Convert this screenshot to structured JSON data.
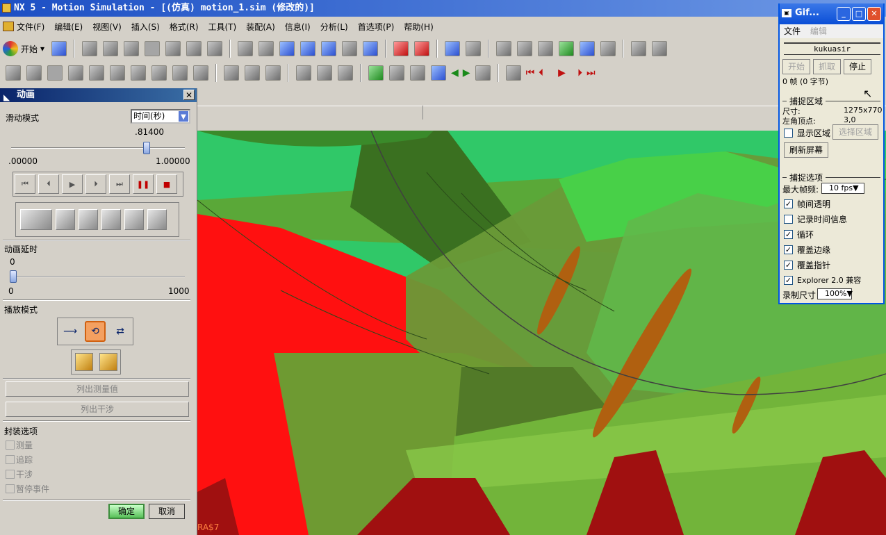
{
  "window": {
    "title": "NX 5 - Motion Simulation - [(仿真) motion_1.sim (修改的)]"
  },
  "menu": [
    "文件(F)",
    "编辑(E)",
    "视图(V)",
    "插入(S)",
    "格式(R)",
    "工具(T)",
    "装配(A)",
    "信息(I)",
    "分析(L)",
    "首选项(P)",
    "帮助(H)"
  ],
  "toolbar": {
    "start_label": "开始"
  },
  "panel": {
    "title": "动画",
    "slide_mode_label": "滑动模式",
    "slide_mode_value": "时间(秒)",
    "slider_value": ".81400",
    "slider_position": 0.814,
    "slider_min": ".00000",
    "slider_max": "1.00000",
    "delay_label": "动画延时",
    "delay_value": "0",
    "delay_min": "0",
    "delay_max": "1000",
    "play_mode_label": "播放模式",
    "list_measure_label": "列出测量值",
    "list_interference_label": "列出干涉",
    "encap_label": "封装选项",
    "encap_items": [
      "测量",
      "追踪",
      "干涉",
      "暂停事件"
    ],
    "ok_label": "确定",
    "cancel_label": "取消"
  },
  "viewport": {
    "overlay_text": "RA$7"
  },
  "gif": {
    "title": "Gif...",
    "menu_file": "文件",
    "menu_edit": "编辑",
    "name": "kukuasir",
    "btn_start": "开始",
    "btn_capture": "抓取",
    "btn_stop": "停止",
    "frames": "0 帧 (0 字节)",
    "capture_area_label": "捕捉区域",
    "size_label": "尺寸:",
    "size_value": "1275x770",
    "topleft_label": "左角顶点:",
    "topleft_value": "3,0",
    "show_area_label": "显示区域",
    "select_area_label": "选择区域",
    "refresh_label": "刷新屏幕",
    "capture_options_label": "捕捉选项",
    "max_fps_label": "最大帧频:",
    "max_fps_value": "10 fps",
    "options": [
      {
        "label": "帧间透明",
        "checked": true
      },
      {
        "label": "记录时间信息",
        "checked": false
      },
      {
        "label": "循环",
        "checked": true
      },
      {
        "label": "覆盖边缘",
        "checked": true
      },
      {
        "label": "覆盖指针",
        "checked": true
      },
      {
        "label": "Explorer 2.0 兼容",
        "checked": true
      }
    ],
    "rec_size_label": "录制尺寸",
    "rec_size_value": "100%"
  }
}
